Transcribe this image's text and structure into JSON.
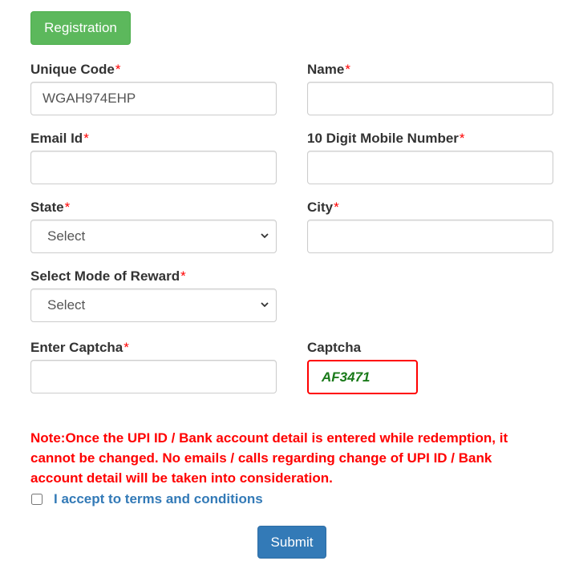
{
  "header": {
    "registration_label": "Registration"
  },
  "colors": {
    "registration_button": "#5cb85c",
    "submit_button": "#337ab7",
    "required_asterisk": "#ff0000",
    "note_text": "#ff0000",
    "captcha_border": "#ff0000",
    "captcha_text": "#1a7a1a",
    "terms_link": "#337ab7"
  },
  "form": {
    "unique_code": {
      "label": "Unique Code",
      "required": "*",
      "value": "WGAH974EHP",
      "placeholder": ""
    },
    "name": {
      "label": "Name",
      "required": "*",
      "value": "",
      "placeholder": ""
    },
    "email": {
      "label": "Email Id",
      "required": "*",
      "value": "",
      "placeholder": ""
    },
    "mobile": {
      "label": "10 Digit Mobile Number",
      "required": "*",
      "value": "",
      "placeholder": ""
    },
    "state": {
      "label": "State",
      "required": "*",
      "selected": "Select",
      "icon": "chevron-down-icon"
    },
    "city": {
      "label": "City",
      "required": "*",
      "value": "",
      "placeholder": ""
    },
    "reward_mode": {
      "label": "Select Mode of Reward",
      "required": "*",
      "selected": "Select",
      "icon": "chevron-down-icon"
    },
    "enter_captcha": {
      "label": "Enter Captcha",
      "required": "*",
      "value": "",
      "placeholder": ""
    },
    "captcha": {
      "label": "Captcha",
      "code": "AF3471"
    }
  },
  "note": "Note:Once the UPI ID / Bank account detail is entered while redemption, it cannot be changed. No emails / calls regarding change of UPI ID / Bank account detail will be taken into consideration.",
  "terms": {
    "label": "I accept to terms and conditions",
    "checked": false
  },
  "submit_label": "Submit"
}
